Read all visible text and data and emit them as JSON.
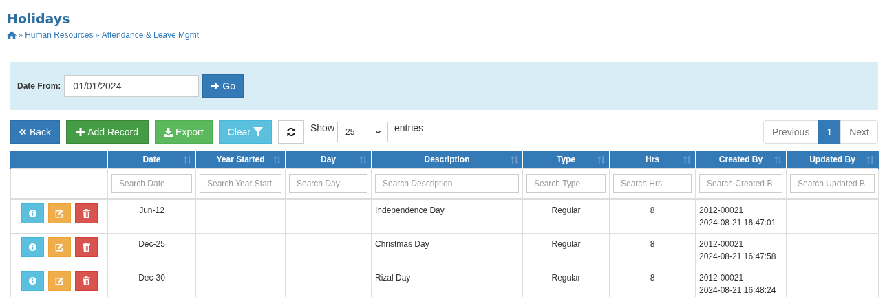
{
  "page_title": "Holidays",
  "breadcrumb": [
    "Human Resources",
    "Attendance & Leave Mgmt"
  ],
  "breadcrumb_separator": "»",
  "filter": {
    "label": "Date From:",
    "value": "01/01/2024",
    "button": "Go"
  },
  "toolbar": {
    "back": "Back",
    "add": "Add Record",
    "export": "Export",
    "clear": "Clear",
    "show_label": "Show",
    "page_size": "25",
    "entries_label": "entries"
  },
  "pagination": [
    {
      "label": "Previous",
      "selected": false
    },
    {
      "label": "1",
      "selected": true
    },
    {
      "label": "Next",
      "selected": false
    }
  ],
  "table": {
    "columns": [
      {
        "label": "Date",
        "placeholder": "Search Date"
      },
      {
        "label": "Year Started",
        "placeholder": "Search Year Start"
      },
      {
        "label": "Day",
        "placeholder": "Search Day"
      },
      {
        "label": "Description",
        "placeholder": "Search Description"
      },
      {
        "label": "Type",
        "placeholder": "Search Type"
      },
      {
        "label": "Hrs",
        "placeholder": "Search Hrs"
      },
      {
        "label": "Created By",
        "placeholder": "Search Created B"
      },
      {
        "label": "Updated By",
        "placeholder": "Search Updated B"
      }
    ],
    "rows": [
      {
        "date": "Jun-12",
        "description": "Independence Day",
        "type": "Regular",
        "hrs": "8",
        "created_by": "2012-00021",
        "created_at": "2024-08-21 16:47:01"
      },
      {
        "date": "Dec-25",
        "description": "Christmas Day",
        "type": "Regular",
        "hrs": "8",
        "created_by": "2012-00021",
        "created_at": "2024-08-21 16:47:58"
      },
      {
        "date": "Dec-30",
        "description": "Rizal Day",
        "type": "Regular",
        "hrs": "8",
        "created_by": "2012-00021",
        "created_at": "2024-08-21 16:48:24"
      }
    ]
  }
}
